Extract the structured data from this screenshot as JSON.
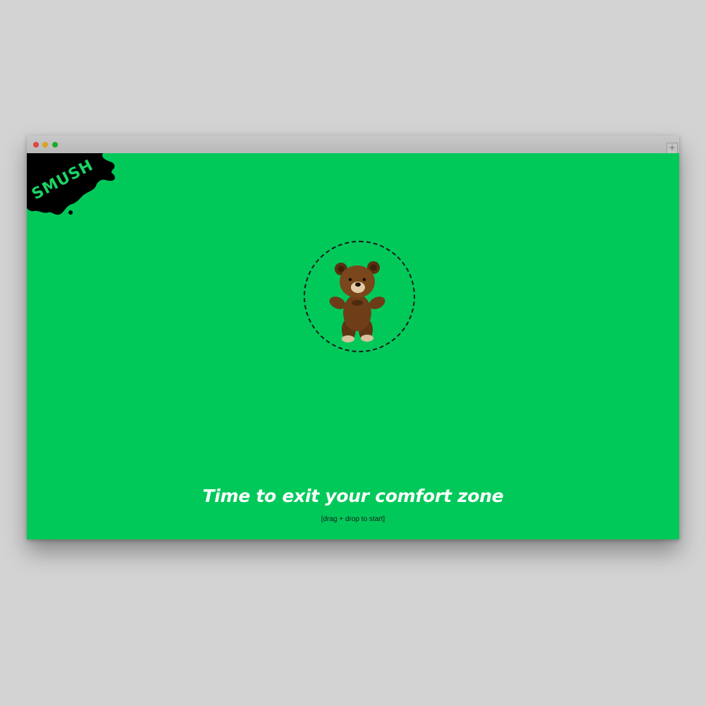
{
  "window": {
    "controls": [
      {
        "name": "close",
        "color": "#e0443e"
      },
      {
        "name": "minimize",
        "color": "#dea123"
      },
      {
        "name": "maximize",
        "color": "#1aab29"
      }
    ],
    "new_tab_glyph": "+"
  },
  "app": {
    "logo_text": "SMUSH",
    "background_color": "#00c95a"
  },
  "dropzone": {
    "object": "teddy-bear",
    "border_style": "dashed"
  },
  "main": {
    "headline": "Time to exit your comfort zone",
    "instruction": "[drag + drop to start]"
  }
}
